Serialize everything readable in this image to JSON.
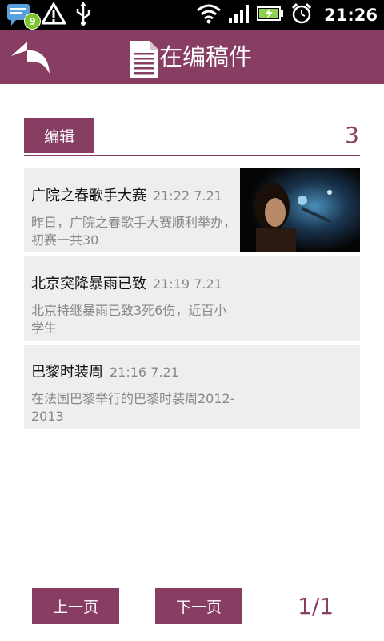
{
  "status_bar": {
    "time": "21:26",
    "notification_count": "9",
    "icons": [
      "chat-notification-icon",
      "warning-icon",
      "usb-icon",
      "wifi-icon",
      "signal-icon",
      "battery-charging-icon",
      "alarm-icon"
    ]
  },
  "header": {
    "title": "在编稿件",
    "back_icon": "back-arrow-icon",
    "title_icon": "document-icon"
  },
  "section": {
    "tab_label": "编辑",
    "count": "3"
  },
  "articles": [
    {
      "title": "广院之春歌手大赛",
      "time": "21:22 7.21",
      "summary": "昨日，广院之春歌手大赛顺利举办，初赛一共30",
      "has_thumbnail": true
    },
    {
      "title": "北京突降暴雨已致",
      "time": "21:19 7.21",
      "summary": "北京持继暴雨已致3死6伤，近百小学生",
      "has_thumbnail": false
    },
    {
      "title": "巴黎时装周",
      "time": "21:16 7.21",
      "summary": "在法国巴黎举行的巴黎时装周2012-2013",
      "has_thumbnail": false
    }
  ],
  "pager": {
    "prev_label": "上一页",
    "next_label": "下一页",
    "indicator": "1/1"
  },
  "colors": {
    "accent": "#873e62",
    "item_bg": "#eeeeee",
    "status_bar_bg": "#000000"
  }
}
